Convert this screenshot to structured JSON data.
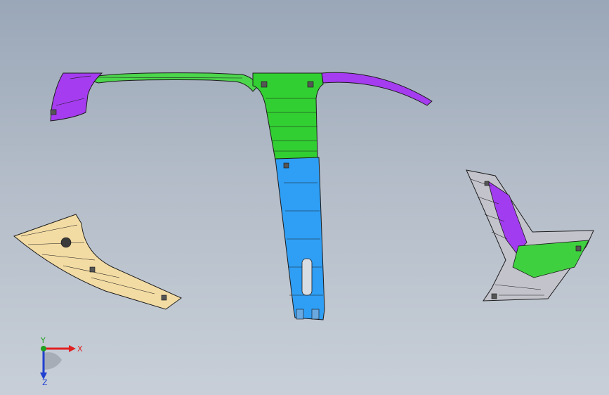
{
  "triad": {
    "x_label": "X",
    "y_label": "Y",
    "z_label": "Z",
    "x_color": "#e02020",
    "y_color": "#20a020",
    "z_color": "#2040d0"
  },
  "parts": [
    {
      "name": "headliner-rail-left-end",
      "color": "#a23cf0"
    },
    {
      "name": "headliner-rail-left",
      "color": "#3fd63f"
    },
    {
      "name": "headliner-rail-right-end",
      "color": "#a23cf0"
    },
    {
      "name": "b-pillar-upper",
      "color": "#2fcf2f"
    },
    {
      "name": "b-pillar-lower",
      "color": "#2f9cf5"
    },
    {
      "name": "a-pillar-trim",
      "color": "#f3dca4"
    },
    {
      "name": "c-pillar-trim",
      "color": "#b8b8c2"
    }
  ]
}
